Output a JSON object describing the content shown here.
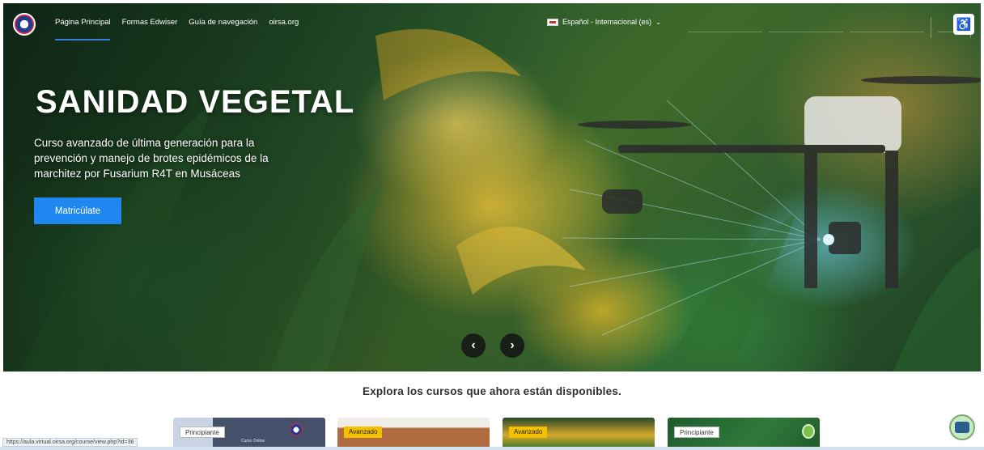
{
  "header": {
    "nav": [
      "Página Principal",
      "Formas Edwiser",
      "Guía de navegación",
      "oirsa.org"
    ],
    "language": "Español - Internacional (es)"
  },
  "hero": {
    "title": "SANIDAD VEGETAL",
    "description": "Curso avanzado de última generación para la prevención y manejo de brotes epidémicos de la marchitez por Fusarium R4T en Musáceas",
    "cta": "Matricúlate"
  },
  "courses": {
    "heading": "Explora los cursos que ahora están disponibles.",
    "cards": [
      {
        "level": "Principiante",
        "caption": "Curso Online"
      },
      {
        "level": "Avanzado"
      },
      {
        "level": "Avanzado"
      },
      {
        "level": "Principiante"
      }
    ]
  },
  "status_url": "https://aula.virtual.oirsa.org/course/view.php?id=36",
  "colors": {
    "accent": "#1e88f0",
    "advanced_badge": "#f5c000"
  },
  "icons": {
    "language": "flag-icon",
    "accessibility": "accessibility-icon",
    "prev": "chevron-left-icon",
    "next": "chevron-right-icon",
    "chat": "chat-icon"
  }
}
